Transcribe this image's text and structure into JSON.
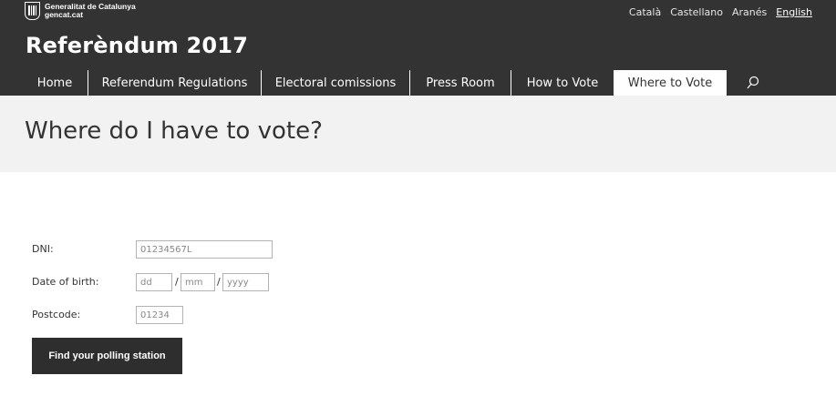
{
  "header": {
    "logo": {
      "line1": "Generalitat de Catalunya",
      "line2": "gencat.cat",
      "icon": "generalitat-emblem-icon"
    },
    "languages": [
      "Català",
      "Castellano",
      "Aranés",
      "English"
    ],
    "active_language": "English",
    "site_title": "Referèndum 2017"
  },
  "nav": {
    "items": [
      "Home",
      "Referendum Regulations",
      "Electoral comissions",
      "Press Room",
      "How to Vote",
      "Where to Vote"
    ],
    "active": "Where to Vote",
    "search_icon": "search-icon"
  },
  "page": {
    "title": "Where do I have to vote?"
  },
  "form": {
    "dni": {
      "label": "DNI:",
      "placeholder": "01234567L"
    },
    "dob": {
      "label": "Date of birth:",
      "day_placeholder": "dd",
      "month_placeholder": "mm",
      "year_placeholder": "yyyy",
      "separator": "/"
    },
    "postcode": {
      "label": "Postcode:",
      "placeholder": "01234"
    },
    "submit_label": "Find your polling station"
  },
  "colors": {
    "header_bg": "#333333",
    "banner_bg": "#f2f2f2",
    "button_bg": "#2e2e2e"
  }
}
